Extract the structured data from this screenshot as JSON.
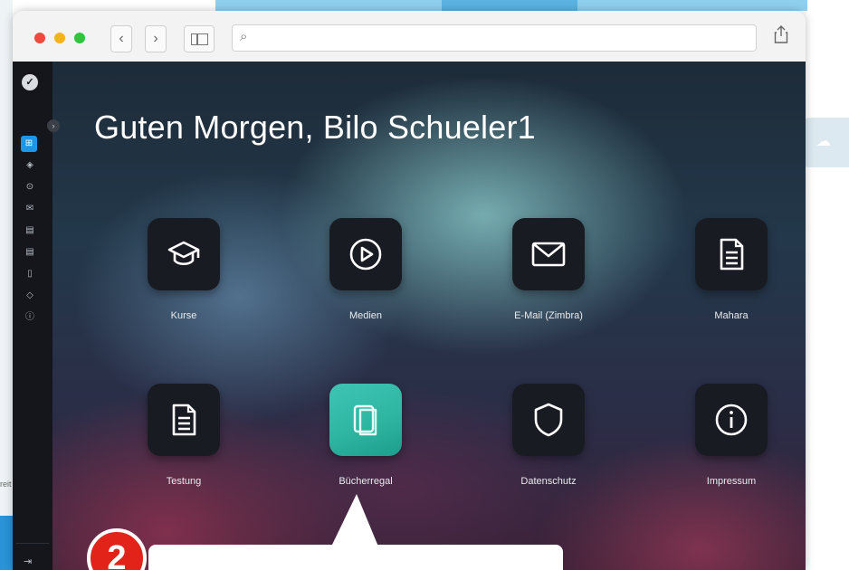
{
  "browser": {
    "address_value": "",
    "address_placeholder": ""
  },
  "app": {
    "greeting": "Guten Morgen, Bilo Schueler1",
    "tiles": [
      {
        "label": "Kurse",
        "icon": "graduation-cap-icon"
      },
      {
        "label": "Medien",
        "icon": "play-circle-icon"
      },
      {
        "label": "E-Mail (Zimbra)",
        "icon": "envelope-icon"
      },
      {
        "label": "Mahara",
        "icon": "document-icon"
      },
      {
        "label": "Testung",
        "icon": "document-icon"
      },
      {
        "label": "Bücherregal",
        "icon": "bookshelf-icon"
      },
      {
        "label": "Datenschutz",
        "icon": "shield-icon"
      },
      {
        "label": "Impressum",
        "icon": "info-circle-icon"
      }
    ],
    "rail_icons": [
      "dashboard-icon",
      "graduation-cap-icon",
      "play-circle-icon",
      "envelope-icon",
      "document-icon",
      "document-icon",
      "bookshelf-icon",
      "shield-icon",
      "info-circle-icon",
      "logout-icon"
    ],
    "highlight_color": "#2fb6a2",
    "active_rail_color": "#1e96e6"
  },
  "annotation": {
    "step_number": "2",
    "badge_color": "#e2231a"
  },
  "background": {
    "left_edge_text": "reit"
  }
}
